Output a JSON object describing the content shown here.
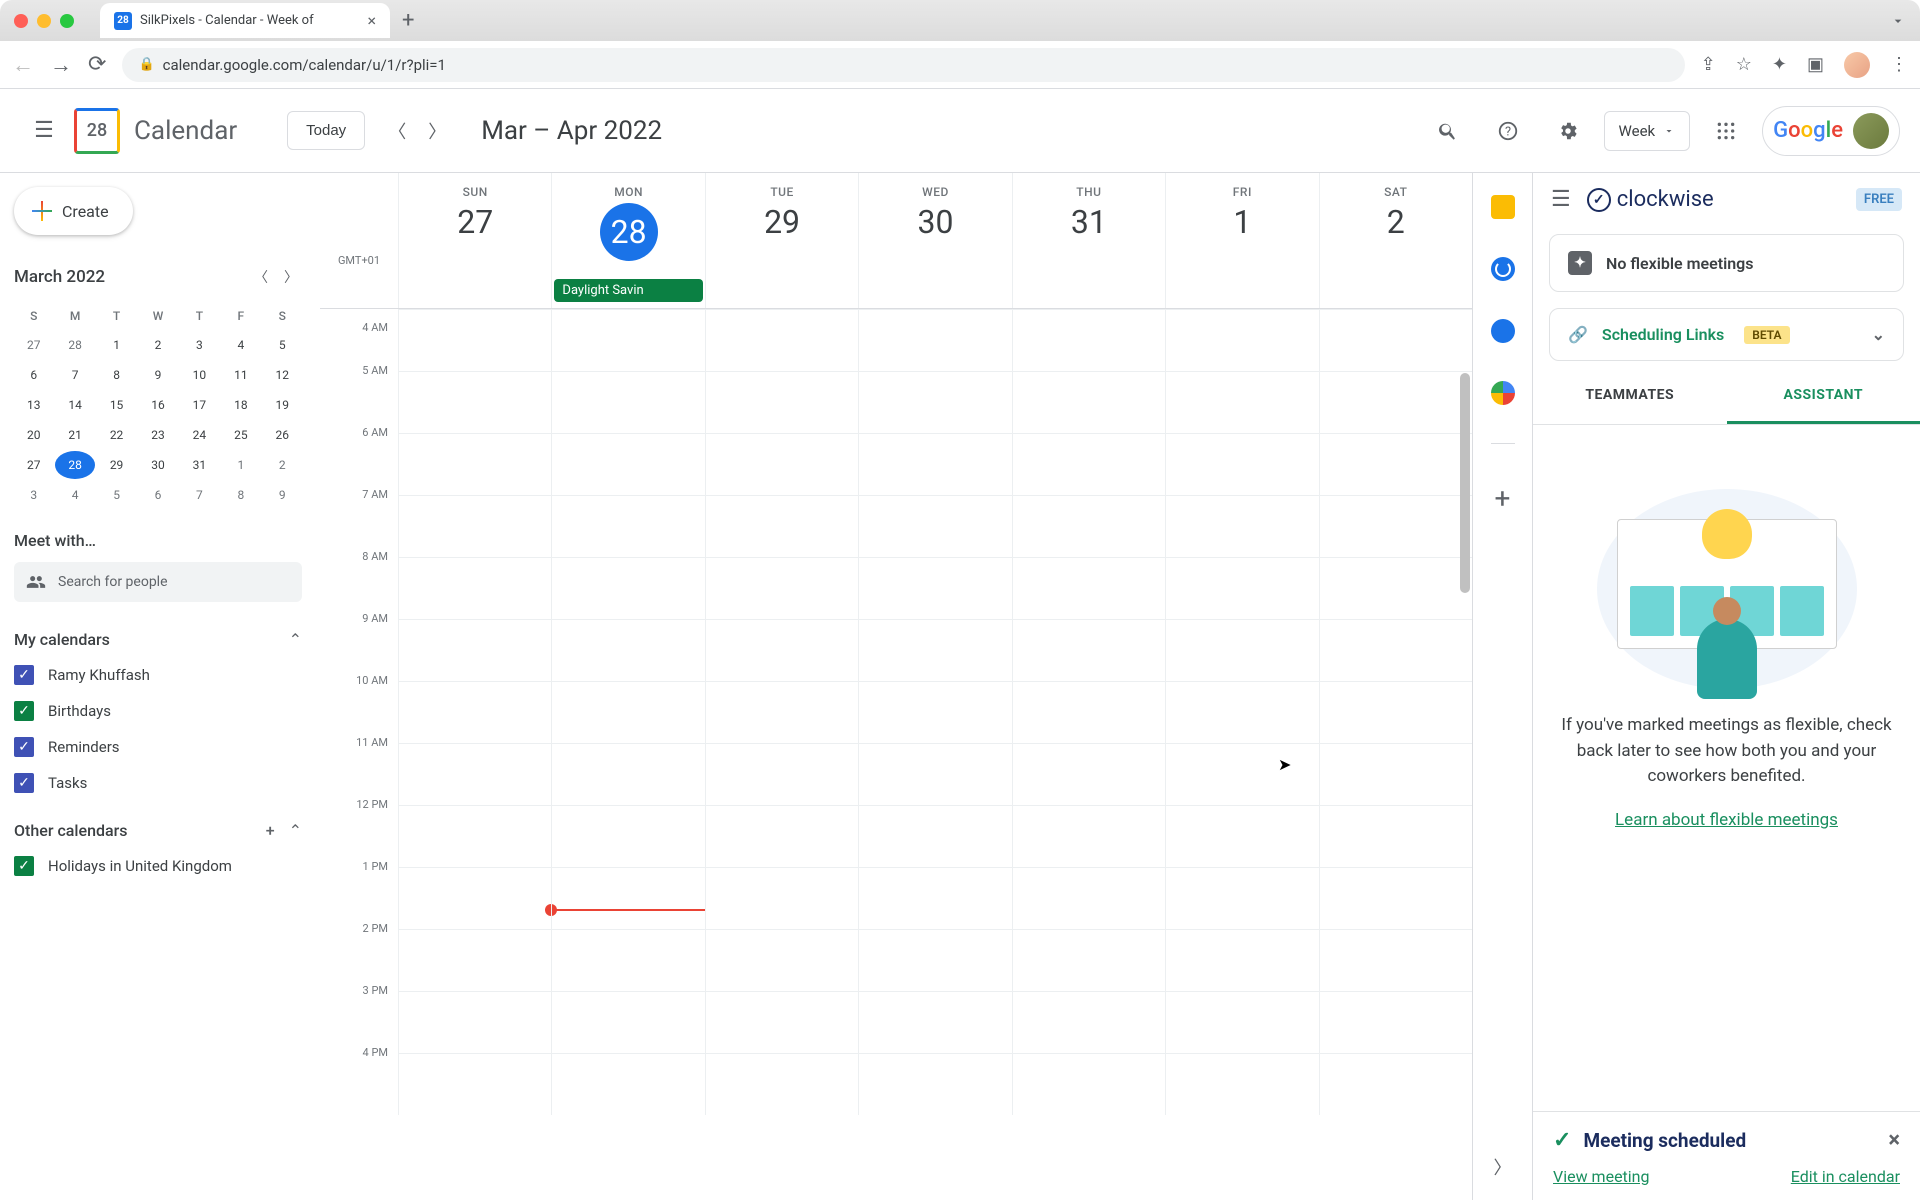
{
  "browser": {
    "tab_title": "SilkPixels - Calendar - Week of",
    "url": "calendar.google.com/calendar/u/1/r?pli=1",
    "favicon_text": "28"
  },
  "header": {
    "logo_text": "Calendar",
    "logo_day": "28",
    "today_btn": "Today",
    "range": "Mar – Apr 2022",
    "view": "Week"
  },
  "sidebar": {
    "create": "Create",
    "mini_month": "March 2022",
    "mini_dows": [
      "S",
      "M",
      "T",
      "W",
      "T",
      "F",
      "S"
    ],
    "mini_days": [
      {
        "d": "27",
        "o": true
      },
      {
        "d": "28",
        "o": true
      },
      {
        "d": "1"
      },
      {
        "d": "2"
      },
      {
        "d": "3"
      },
      {
        "d": "4"
      },
      {
        "d": "5"
      },
      {
        "d": "6"
      },
      {
        "d": "7"
      },
      {
        "d": "8"
      },
      {
        "d": "9"
      },
      {
        "d": "10"
      },
      {
        "d": "11"
      },
      {
        "d": "12"
      },
      {
        "d": "13"
      },
      {
        "d": "14"
      },
      {
        "d": "15"
      },
      {
        "d": "16"
      },
      {
        "d": "17"
      },
      {
        "d": "18"
      },
      {
        "d": "19"
      },
      {
        "d": "20"
      },
      {
        "d": "21"
      },
      {
        "d": "22"
      },
      {
        "d": "23"
      },
      {
        "d": "24"
      },
      {
        "d": "25"
      },
      {
        "d": "26"
      },
      {
        "d": "27"
      },
      {
        "d": "28",
        "t": true
      },
      {
        "d": "29"
      },
      {
        "d": "30"
      },
      {
        "d": "31"
      },
      {
        "d": "1",
        "o": true
      },
      {
        "d": "2",
        "o": true
      },
      {
        "d": "3",
        "o": true
      },
      {
        "d": "4",
        "o": true
      },
      {
        "d": "5",
        "o": true
      },
      {
        "d": "6",
        "o": true
      },
      {
        "d": "7",
        "o": true
      },
      {
        "d": "8",
        "o": true
      },
      {
        "d": "9",
        "o": true
      }
    ],
    "meet_with": "Meet with…",
    "search_placeholder": "Search for people",
    "my_calendars": "My calendars",
    "my_cals": [
      {
        "name": "Ramy Khuffash",
        "color": "blue"
      },
      {
        "name": "Birthdays",
        "color": "green"
      },
      {
        "name": "Reminders",
        "color": "blue"
      },
      {
        "name": "Tasks",
        "color": "blue"
      }
    ],
    "other_calendars": "Other calendars",
    "other_cals": [
      {
        "name": "Holidays in United Kingdom",
        "color": "green"
      }
    ]
  },
  "grid": {
    "gmt": "GMT+01",
    "days": [
      {
        "dow": "SUN",
        "num": "27"
      },
      {
        "dow": "MON",
        "num": "28",
        "today": true
      },
      {
        "dow": "TUE",
        "num": "29"
      },
      {
        "dow": "WED",
        "num": "30"
      },
      {
        "dow": "THU",
        "num": "31"
      },
      {
        "dow": "FRI",
        "num": "1"
      },
      {
        "dow": "SAT",
        "num": "2"
      }
    ],
    "allday_event": "Daylight Savin",
    "hours": [
      "4 AM",
      "5 AM",
      "6 AM",
      "7 AM",
      "8 AM",
      "9 AM",
      "10 AM",
      "11 AM",
      "12 PM",
      "1 PM",
      "2 PM",
      "3 PM",
      "4 PM"
    ]
  },
  "clockwise": {
    "brand": "clockwise",
    "free": "FREE",
    "no_flex": "No flexible meetings",
    "sched_links": "Scheduling Links",
    "beta": "BETA",
    "tab_team": "TEAMMATES",
    "tab_assist": "ASSISTANT",
    "body_text": "If you've marked meetings as flexible, check back later to see how both you and your coworkers benefited.",
    "learn_link": "Learn about flexible meetings",
    "toast_title": "Meeting scheduled",
    "toast_view": "View meeting",
    "toast_edit": "Edit in calendar"
  }
}
